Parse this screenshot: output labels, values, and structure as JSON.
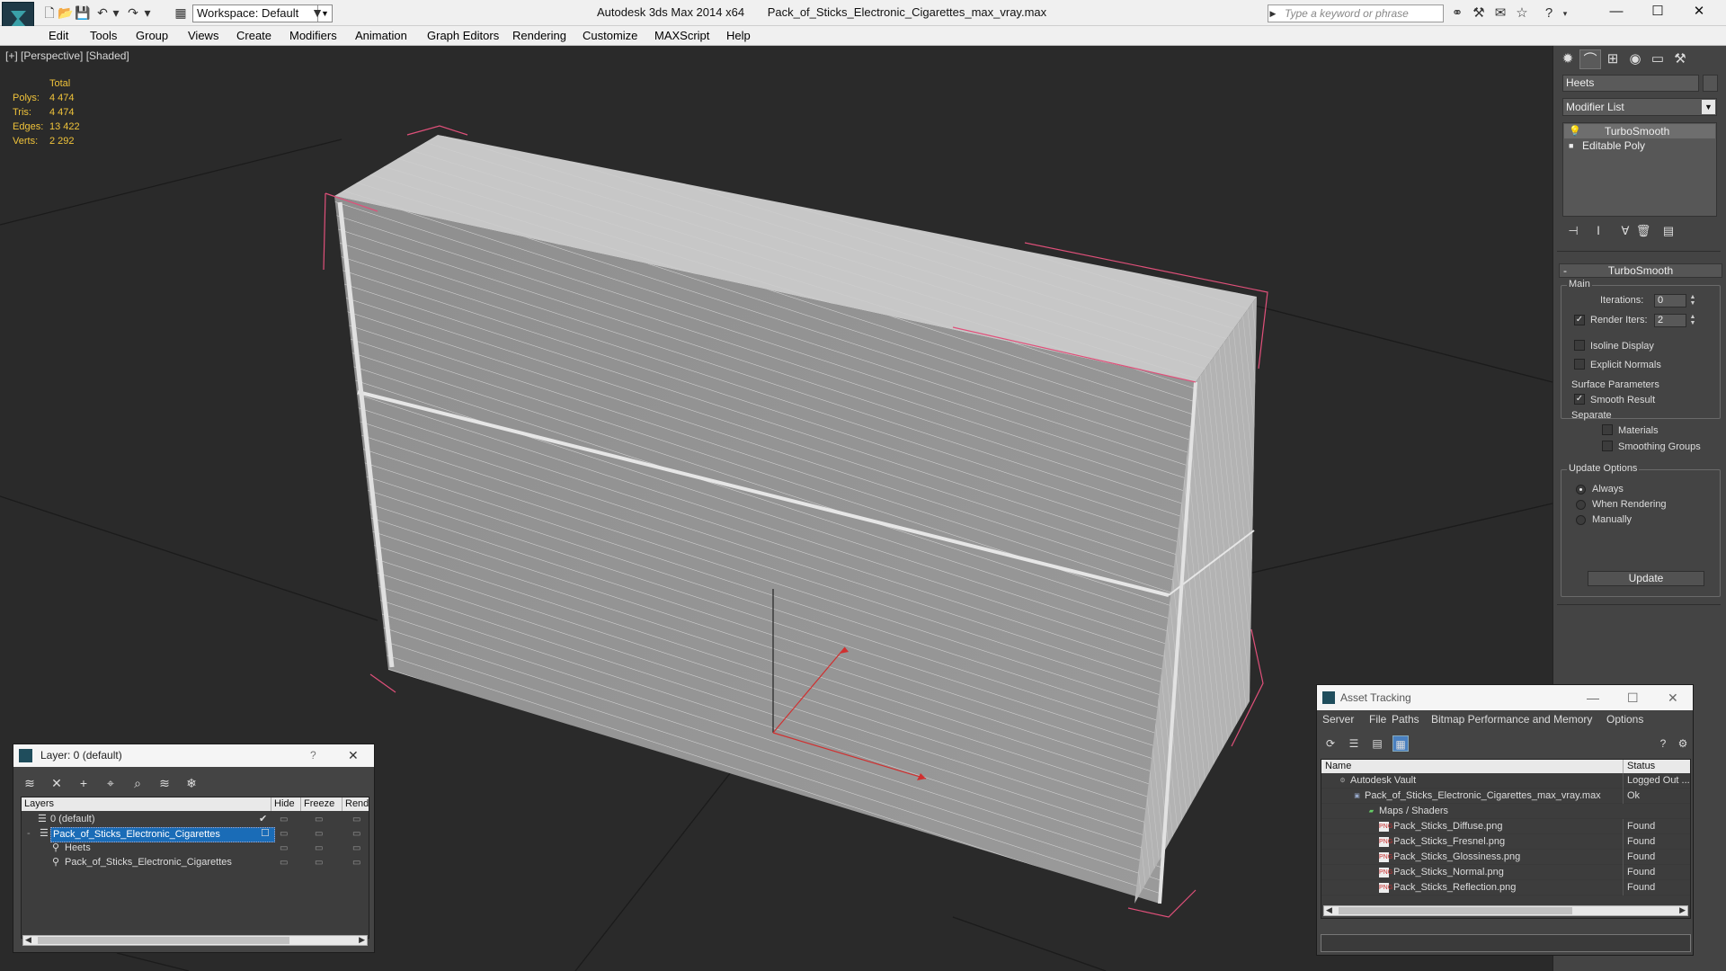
{
  "titlebar": {
    "workspace": "Workspace: Default",
    "app_name": "Autodesk 3ds Max  2014 x64",
    "file_name": "Pack_of_Sticks_Electronic_Cigarettes_max_vray.max",
    "search_placeholder": "Type a keyword or phrase",
    "minimize": "—",
    "maximize": "☐",
    "close": "✕"
  },
  "menu": [
    "Edit",
    "Tools",
    "Group",
    "Views",
    "Create",
    "Modifiers",
    "Animation",
    "Graph Editors",
    "Rendering",
    "Customize",
    "MAXScript",
    "Help"
  ],
  "viewport": {
    "label": "[+] [Perspective] [Shaded]",
    "stats": {
      "header": "Total",
      "rows": [
        {
          "k": "Polys:",
          "v": "4 474"
        },
        {
          "k": "Tris:",
          "v": "4 474"
        },
        {
          "k": "Edges:",
          "v": "13 422"
        },
        {
          "k": "Verts:",
          "v": "2 292"
        }
      ]
    }
  },
  "command_panel": {
    "object_name": "Heets",
    "modifier_list": "Modifier List",
    "stack": [
      "TurboSmooth",
      "Editable Poly"
    ],
    "rollout_title": "TurboSmooth",
    "main_group": "Main",
    "iterations_label": "Iterations:",
    "iterations_value": "0",
    "render_iters_label": "Render Iters:",
    "render_iters_value": "2",
    "render_iters_checked": true,
    "isoline_display": "Isoline Display",
    "explicit_normals": "Explicit Normals",
    "surface_params": "Surface Parameters",
    "smooth_result": "Smooth Result",
    "separate": "Separate",
    "materials": "Materials",
    "smoothing_groups": "Smoothing Groups",
    "update_options": "Update Options",
    "always": "Always",
    "when_rendering": "When Rendering",
    "manually": "Manually",
    "update_button": "Update"
  },
  "layer_window": {
    "title": "Layer: 0 (default)",
    "help": "?",
    "close": "✕",
    "columns": [
      "Layers",
      "Hide",
      "Freeze",
      "Rende"
    ],
    "rows": [
      {
        "name": "0 (default)",
        "indent": 1,
        "selected": false
      },
      {
        "name": "Pack_of_Sticks_Electronic_Cigarettes",
        "indent": 1,
        "selected": true
      },
      {
        "name": "Heets",
        "indent": 2,
        "selected": false
      },
      {
        "name": "Pack_of_Sticks_Electronic_Cigarettes",
        "indent": 2,
        "selected": false
      }
    ]
  },
  "asset_window": {
    "title": "Asset Tracking",
    "menu": [
      "Server",
      "File",
      "Paths",
      "Bitmap Performance and Memory",
      "Options"
    ],
    "col_name": "Name",
    "col_status": "Status",
    "rows": [
      {
        "name": "Autodesk Vault",
        "status": "Logged Out ...",
        "indent": 0,
        "icon": "vault"
      },
      {
        "name": "Pack_of_Sticks_Electronic_Cigarettes_max_vray.max",
        "status": "Ok",
        "indent": 1,
        "icon": "file"
      },
      {
        "name": "Maps / Shaders",
        "status": "",
        "indent": 2,
        "icon": "folder"
      },
      {
        "name": "Pack_Sticks_Diffuse.png",
        "status": "Found",
        "indent": 3,
        "icon": "png"
      },
      {
        "name": "Pack_Sticks_Fresnel.png",
        "status": "Found",
        "indent": 3,
        "icon": "png"
      },
      {
        "name": "Pack_Sticks_Glossiness.png",
        "status": "Found",
        "indent": 3,
        "icon": "png"
      },
      {
        "name": "Pack_Sticks_Normal.png",
        "status": "Found",
        "indent": 3,
        "icon": "png"
      },
      {
        "name": "Pack_Sticks_Reflection.png",
        "status": "Found",
        "indent": 3,
        "icon": "png"
      }
    ]
  }
}
